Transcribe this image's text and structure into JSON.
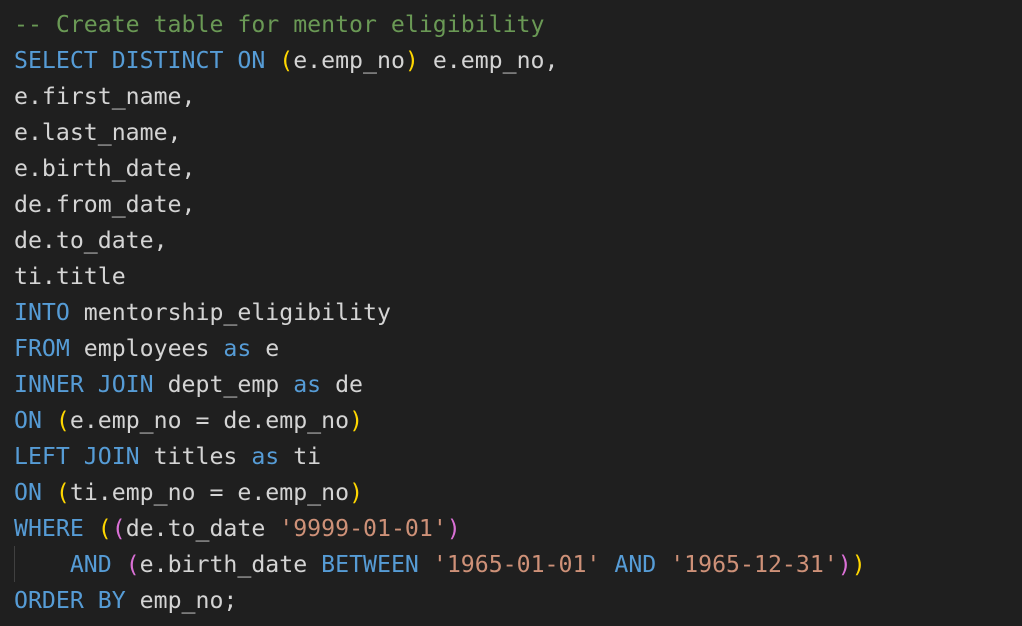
{
  "theme": {
    "background": "#1f1f1f",
    "colors": {
      "comment": "#6a9955",
      "keyword": "#569cd6",
      "text": "#d4d4d4",
      "string": "#ce9178",
      "bracket1": "#ffd700",
      "bracket2": "#da70d6"
    }
  },
  "code": {
    "lines": [
      {
        "indent": false,
        "segments": [
          {
            "text": "-- Create table for mentor eligibility",
            "type": "comment"
          }
        ]
      },
      {
        "indent": false,
        "segments": [
          {
            "text": "SELECT DISTINCT ON ",
            "type": "keyword"
          },
          {
            "text": "(",
            "type": "bracket1"
          },
          {
            "text": "e.emp_no",
            "type": "text"
          },
          {
            "text": ")",
            "type": "bracket1"
          },
          {
            "text": " e.emp_no,",
            "type": "text"
          }
        ]
      },
      {
        "indent": false,
        "segments": [
          {
            "text": "e.first_name,",
            "type": "text"
          }
        ]
      },
      {
        "indent": false,
        "segments": [
          {
            "text": "e.last_name,",
            "type": "text"
          }
        ]
      },
      {
        "indent": false,
        "segments": [
          {
            "text": "e.birth_date,",
            "type": "text"
          }
        ]
      },
      {
        "indent": false,
        "segments": [
          {
            "text": "de.from_date,",
            "type": "text"
          }
        ]
      },
      {
        "indent": false,
        "segments": [
          {
            "text": "de.to_date,",
            "type": "text"
          }
        ]
      },
      {
        "indent": false,
        "segments": [
          {
            "text": "ti.title",
            "type": "text"
          }
        ]
      },
      {
        "indent": false,
        "segments": [
          {
            "text": "INTO",
            "type": "keyword"
          },
          {
            "text": " mentorship_eligibility",
            "type": "text"
          }
        ]
      },
      {
        "indent": false,
        "segments": [
          {
            "text": "FROM",
            "type": "keyword"
          },
          {
            "text": " employees ",
            "type": "text"
          },
          {
            "text": "as",
            "type": "keyword"
          },
          {
            "text": " e",
            "type": "text"
          }
        ]
      },
      {
        "indent": false,
        "segments": [
          {
            "text": "INNER JOIN",
            "type": "keyword"
          },
          {
            "text": " dept_emp ",
            "type": "text"
          },
          {
            "text": "as",
            "type": "keyword"
          },
          {
            "text": " de",
            "type": "text"
          }
        ]
      },
      {
        "indent": false,
        "segments": [
          {
            "text": "ON ",
            "type": "keyword"
          },
          {
            "text": "(",
            "type": "bracket1"
          },
          {
            "text": "e.emp_no = de.emp_no",
            "type": "text"
          },
          {
            "text": ")",
            "type": "bracket1"
          }
        ]
      },
      {
        "indent": false,
        "segments": [
          {
            "text": "LEFT JOIN",
            "type": "keyword"
          },
          {
            "text": " titles ",
            "type": "text"
          },
          {
            "text": "as",
            "type": "keyword"
          },
          {
            "text": " ti",
            "type": "text"
          }
        ]
      },
      {
        "indent": false,
        "segments": [
          {
            "text": "ON ",
            "type": "keyword"
          },
          {
            "text": "(",
            "type": "bracket1"
          },
          {
            "text": "ti.emp_no = e.emp_no",
            "type": "text"
          },
          {
            "text": ")",
            "type": "bracket1"
          }
        ]
      },
      {
        "indent": false,
        "segments": [
          {
            "text": "WHERE ",
            "type": "keyword"
          },
          {
            "text": "(",
            "type": "bracket1"
          },
          {
            "text": "(",
            "type": "bracket2"
          },
          {
            "text": "de.to_date ",
            "type": "text"
          },
          {
            "text": "'9999-01-01'",
            "type": "string"
          },
          {
            "text": ")",
            "type": "bracket2"
          }
        ]
      },
      {
        "indent": true,
        "segments": [
          {
            "text": "    ",
            "type": "text"
          },
          {
            "text": "AND",
            "type": "keyword"
          },
          {
            "text": " ",
            "type": "text"
          },
          {
            "text": "(",
            "type": "bracket2"
          },
          {
            "text": "e.birth_date ",
            "type": "text"
          },
          {
            "text": "BETWEEN",
            "type": "keyword"
          },
          {
            "text": " ",
            "type": "text"
          },
          {
            "text": "'1965-01-01'",
            "type": "string"
          },
          {
            "text": " ",
            "type": "text"
          },
          {
            "text": "AND",
            "type": "keyword"
          },
          {
            "text": " ",
            "type": "text"
          },
          {
            "text": "'1965-12-31'",
            "type": "string"
          },
          {
            "text": ")",
            "type": "bracket2"
          },
          {
            "text": ")",
            "type": "bracket1"
          }
        ]
      },
      {
        "indent": false,
        "segments": [
          {
            "text": "ORDER BY",
            "type": "keyword"
          },
          {
            "text": " emp_no;",
            "type": "text"
          }
        ]
      }
    ]
  }
}
